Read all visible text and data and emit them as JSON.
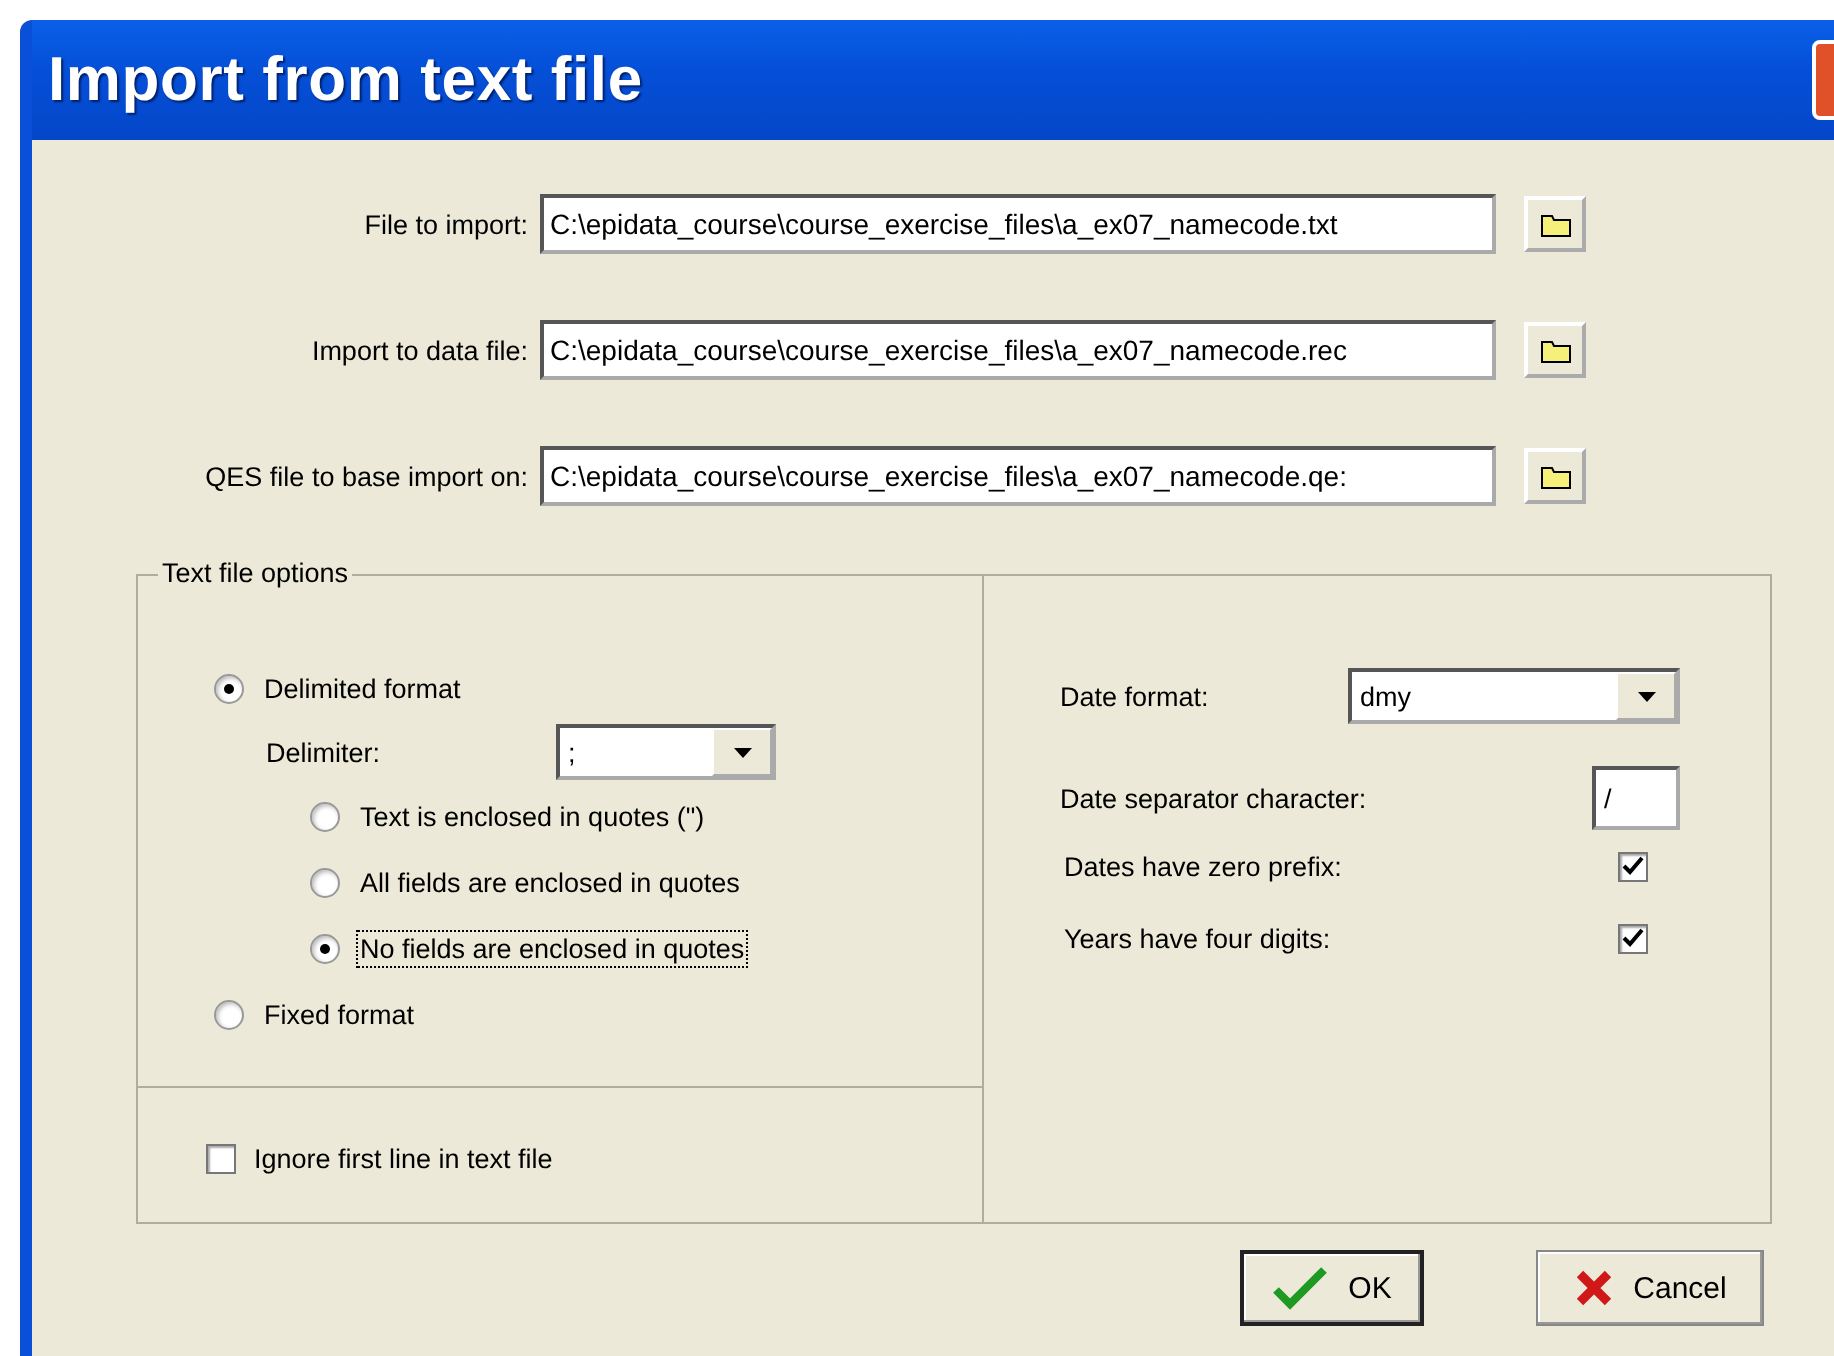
{
  "window": {
    "title": "Import from text file"
  },
  "files": [
    {
      "label": "File to import:",
      "value": "C:\\epidata_course\\course_exercise_files\\a_ex07_namecode.txt"
    },
    {
      "label": "Import to data file:",
      "value": "C:\\epidata_course\\course_exercise_files\\a_ex07_namecode.rec"
    },
    {
      "label": "QES file to base import on:",
      "value": "C:\\epidata_course\\course_exercise_files\\a_ex07_namecode.qe:"
    }
  ],
  "text_file_options": {
    "title": "Text file options",
    "formats": [
      {
        "label": "Delimited format",
        "selected": true
      },
      {
        "label": "Fixed format",
        "selected": false
      }
    ],
    "delimiter": {
      "label": "Delimiter:",
      "value": ";"
    },
    "quote_options": [
      {
        "label": "Text is enclosed in quotes (\")",
        "selected": false,
        "focused": false
      },
      {
        "label": "All fields are enclosed in quotes",
        "selected": false,
        "focused": false
      },
      {
        "label": "No fields are enclosed in quotes",
        "selected": true,
        "focused": true
      }
    ],
    "ignore_first_line": {
      "label": "Ignore first line in text file",
      "checked": false
    }
  },
  "date_options": {
    "date_format": {
      "label": "Date format:",
      "value": "dmy"
    },
    "separator": {
      "label": "Date separator character:",
      "value": "/"
    },
    "checkboxes": [
      {
        "label": "Dates have zero prefix:",
        "checked": true
      },
      {
        "label": "Years have four digits:",
        "checked": true
      }
    ]
  },
  "buttons": [
    {
      "label": "OK",
      "kind": "ok"
    },
    {
      "label": "Cancel",
      "kind": "cancel"
    }
  ]
}
